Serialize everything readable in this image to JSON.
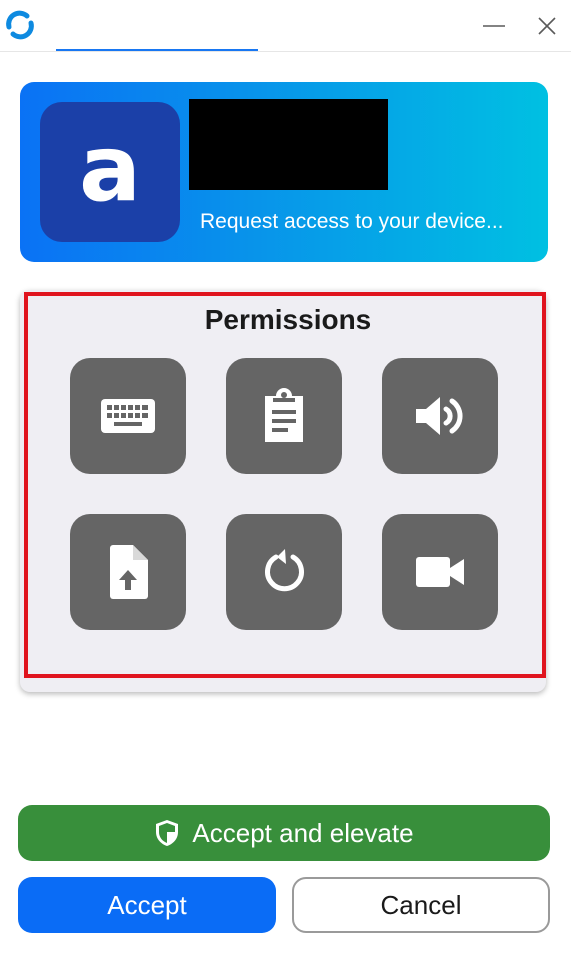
{
  "window": {
    "logo_icon": "rustdesk-logo-icon",
    "minimize_icon": "minimize-icon",
    "close_icon": "close-icon",
    "accent_color": "#1877f2"
  },
  "header": {
    "avatar_letter": "a",
    "avatar_color": "#1b40a8",
    "request_text": "Request access to your device..."
  },
  "permissions": {
    "title": "Permissions",
    "items": [
      {
        "icon": "keyboard-icon"
      },
      {
        "icon": "clipboard-icon"
      },
      {
        "icon": "speaker-icon"
      },
      {
        "icon": "file-upload-icon"
      },
      {
        "icon": "restart-icon"
      },
      {
        "icon": "video-camera-icon"
      }
    ],
    "tile_color": "#656565"
  },
  "buttons": {
    "elevate_label": "Accept and elevate",
    "elevate_icon": "shield-icon",
    "elevate_color": "#388f3b",
    "accept_label": "Accept",
    "accept_color": "#0a6cf6",
    "cancel_label": "Cancel"
  }
}
